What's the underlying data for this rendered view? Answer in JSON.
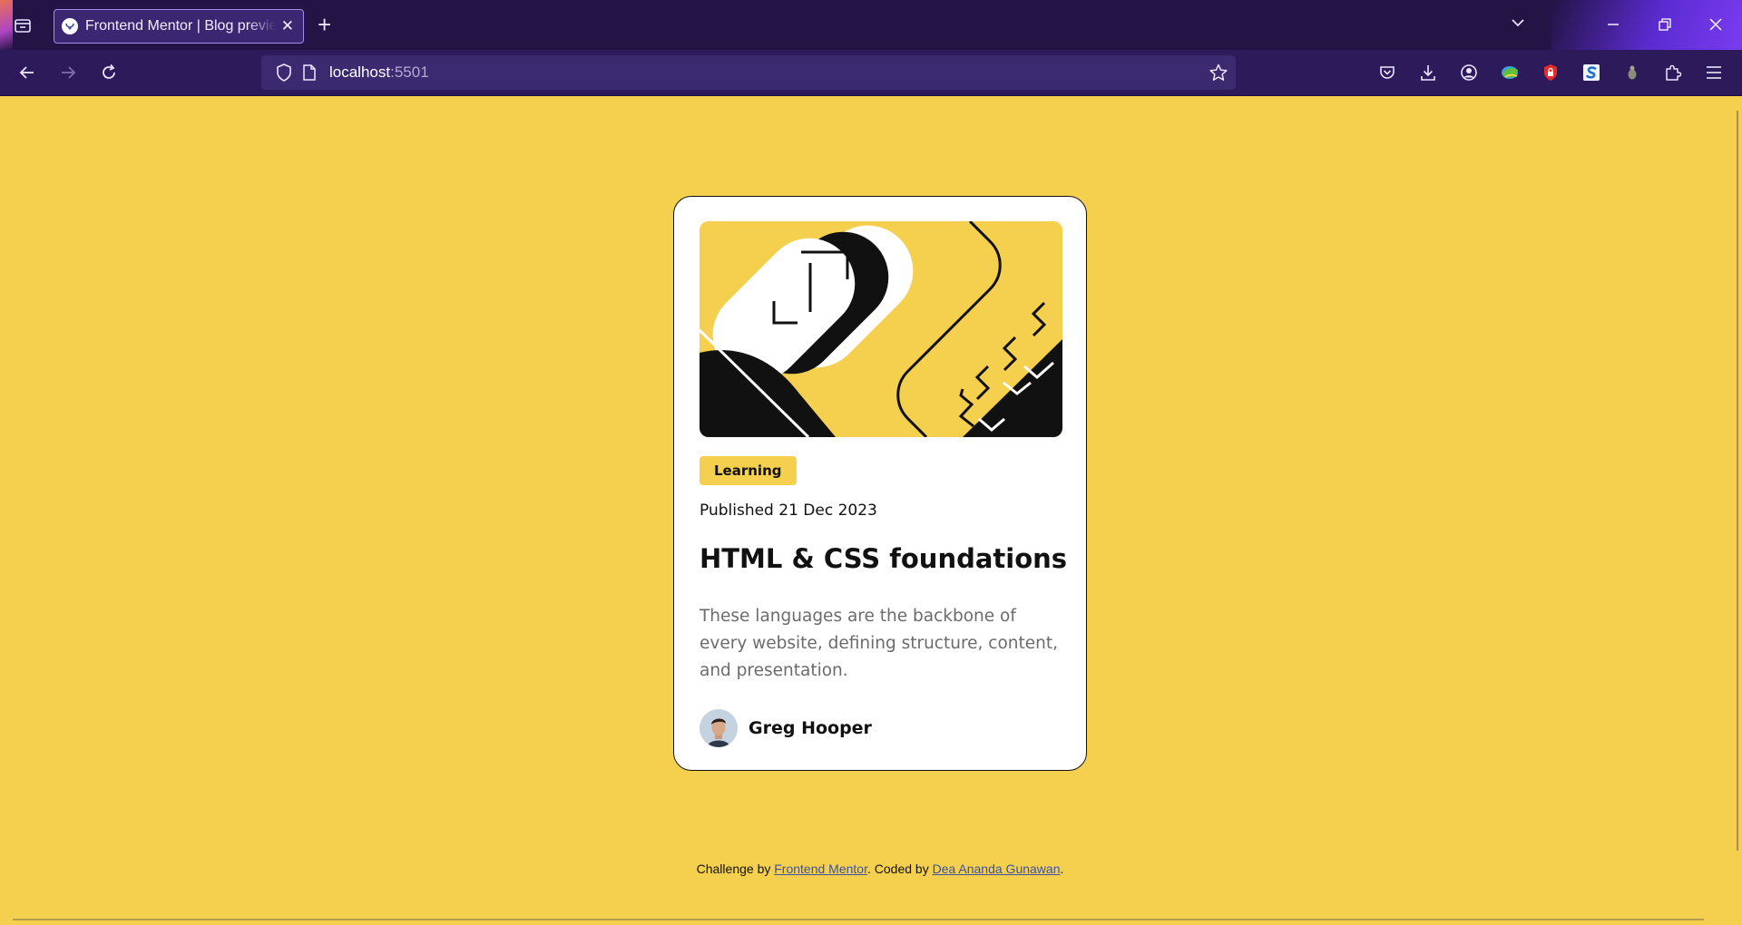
{
  "browser": {
    "tab": {
      "title": "Frontend Mentor | Blog preview card"
    },
    "url": {
      "host": "localhost",
      "port": ":5501"
    }
  },
  "card": {
    "tag": "Learning",
    "published": "Published 21 Dec 2023",
    "title": "HTML & CSS foundations",
    "description": "These languages are the backbone of every website, defining structure, content, and presentation.",
    "author": "Greg Hooper"
  },
  "attribution": {
    "prefix": "Challenge by ",
    "challenge_link": "Frontend Mentor",
    "middle": ". Coded by ",
    "author_link": "Dea Ananda Gunawan",
    "suffix": "."
  },
  "colors": {
    "page_background": "#f4d04e",
    "card_background": "#ffffff",
    "text": "#111111",
    "muted_text": "#6b6b6b",
    "tabbar": "#231445",
    "navbar": "#2c1a5a"
  }
}
